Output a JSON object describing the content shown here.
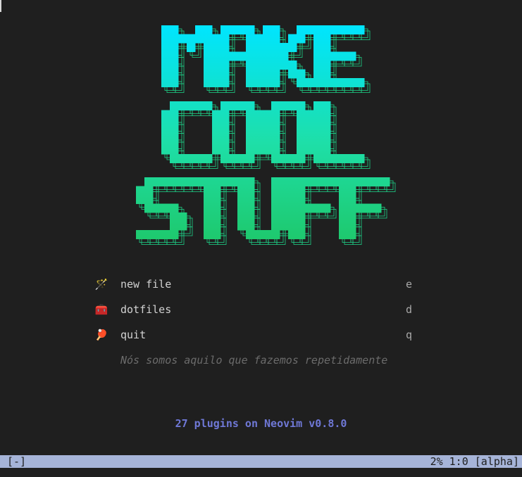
{
  "banner": {
    "lines": [
      "MAKE",
      "COOL",
      "STUFF"
    ],
    "gradient_top": "#00e5ff",
    "gradient_mid": "#1edfa8",
    "gradient_bottom": "#1ec96e"
  },
  "menu": [
    {
      "icon": "wand-icon",
      "glyph": "🪄",
      "label": "new file",
      "key": "e"
    },
    {
      "icon": "toolbox-icon",
      "glyph": "🧰",
      "label": "dotfiles",
      "key": "d"
    },
    {
      "icon": "ping-pong-icon",
      "glyph": "🏓",
      "label": "quit",
      "key": "q"
    }
  ],
  "quote": "Nós somos aquilo que fazemos repetidamente",
  "footer": "27 plugins on Neovim v0.8.0",
  "statusline": {
    "left": "[-]",
    "right": "2% 1:0 [alpha]"
  }
}
